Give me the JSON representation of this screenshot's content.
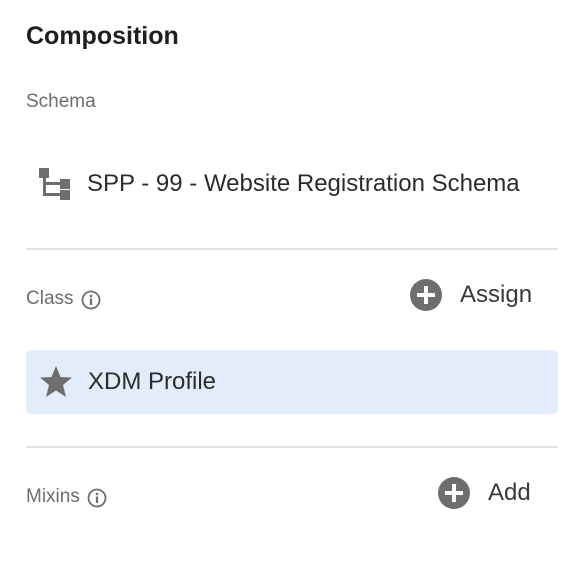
{
  "panel": {
    "title": "Composition"
  },
  "schema": {
    "label": "Schema",
    "name": "SPP - 99 - Website Registration Schema",
    "icon": "schema-tree-icon"
  },
  "class_section": {
    "label": "Class",
    "info_icon": "info-icon",
    "assign_label": "Assign",
    "assign_icon": "add-circle-icon",
    "items": [
      {
        "label": "XDM Profile",
        "icon": "star-icon",
        "selected": true
      }
    ]
  },
  "mixins_section": {
    "label": "Mixins",
    "info_icon": "info-icon",
    "add_label": "Add",
    "add_icon": "add-circle-icon"
  },
  "colors": {
    "selected_background": "#e2ecfb",
    "icon_gray": "#6e6e6e",
    "divider": "#e3e3e3"
  }
}
